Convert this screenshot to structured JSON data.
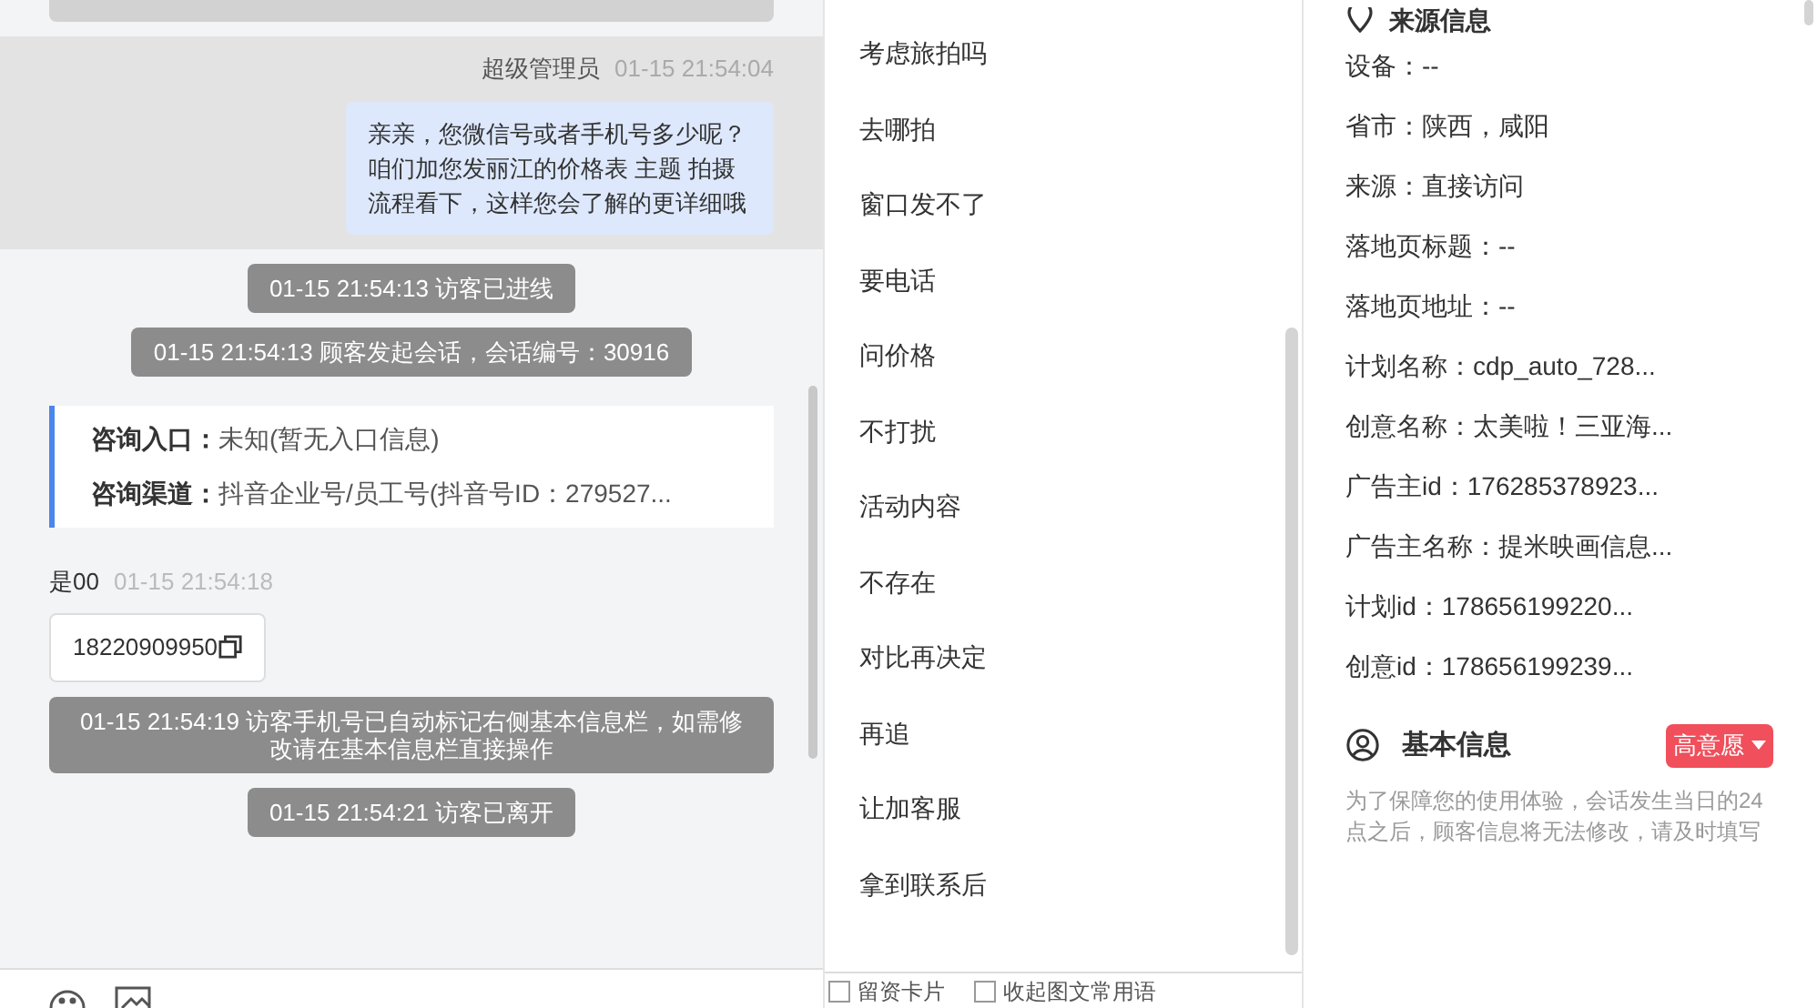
{
  "chat": {
    "messages": [
      {
        "kind": "agent",
        "sender": "超级管理员",
        "time": "01-15 21:54:04",
        "text": "亲亲，您微信号或者手机号多少呢？咱们加您发丽江的价格表 主题 拍摄流程看下，这样您会了解的更详细哦",
        "highlighted": true
      },
      {
        "kind": "system",
        "text": "01-15 21:54:13 访客已进线"
      },
      {
        "kind": "system",
        "text": "01-15 21:54:13 顾客发起会话，会话编号：30916"
      },
      {
        "kind": "info",
        "rows": [
          {
            "label": "咨询入口：",
            "value": "未知(暂无入口信息)"
          },
          {
            "label": "咨询渠道：",
            "value": "抖音企业号/员工号(抖音号ID：279527..."
          }
        ]
      },
      {
        "kind": "visitor",
        "sender": "是00",
        "time": "01-15 21:54:18",
        "text": "18220909950"
      },
      {
        "kind": "system",
        "text": "01-15 21:54:19 访客手机号已自动标记右侧基本信息栏，如需修改请在基本信息栏直接操作"
      },
      {
        "kind": "system",
        "text": "01-15 21:54:21 访客已离开"
      }
    ]
  },
  "phrases": {
    "items": [
      "考虑旅拍吗",
      "去哪拍",
      "窗口发不了",
      "要电话",
      "问价格",
      "不打扰",
      "活动内容",
      "不存在",
      "对比再决定",
      "再追",
      "让加客服",
      "拿到联系后"
    ],
    "options": [
      {
        "label": "留资卡片",
        "checked": false
      },
      {
        "label": "收起图文常用语",
        "checked": false
      }
    ]
  },
  "source_info": {
    "title": "来源信息",
    "fields": [
      "设备：--",
      "省市：陕西，咸阳",
      "来源：直接访问",
      "落地页标题：--",
      "落地页地址：--",
      "计划名称：cdp_auto_728...",
      "创意名称：太美啦！三亚海...",
      "广告主id：176285378923...",
      "广告主名称：提米映画信息...",
      "计划id：178656199220...",
      "创意id：178656199239..."
    ]
  },
  "basic_info": {
    "title": "基本信息",
    "intent": {
      "label": "高意愿",
      "color": "#f04f5b"
    },
    "note": "为了保障您的使用体验，会话发生当日的24点之后，顾客信息将无法修改，请及时填写"
  }
}
